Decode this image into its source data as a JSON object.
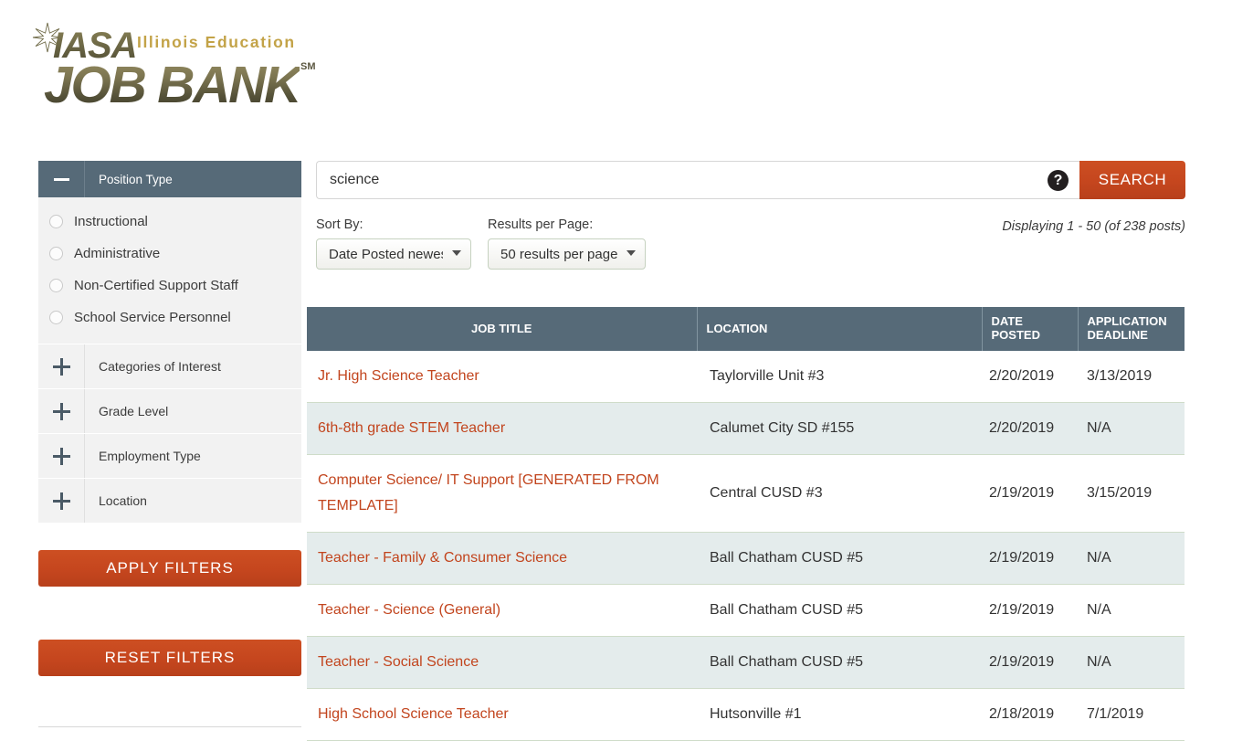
{
  "logo": {
    "star_icon": "star-icon",
    "acronym": "IASA",
    "tagline": "Illinois Education",
    "title": "JOB BANK",
    "trademark": "SM"
  },
  "sidebar": {
    "open_section": {
      "label": "Position Type",
      "toggle_icon": "minus-icon",
      "options": [
        {
          "label": "Instructional"
        },
        {
          "label": "Administrative"
        },
        {
          "label": "Non-Certified Support Staff"
        },
        {
          "label": "School Service Personnel"
        }
      ]
    },
    "closed_sections": [
      {
        "label": "Categories of Interest",
        "toggle_icon": "plus-icon"
      },
      {
        "label": "Grade Level",
        "toggle_icon": "plus-icon"
      },
      {
        "label": "Employment Type",
        "toggle_icon": "plus-icon"
      },
      {
        "label": "Location",
        "toggle_icon": "plus-icon"
      }
    ],
    "apply_label": "APPLY FILTERS",
    "reset_label": "RESET FILTERS"
  },
  "search": {
    "value": "science",
    "placeholder": "",
    "help_icon": "question-mark-icon",
    "help_glyph": "?",
    "button_label": "SEARCH"
  },
  "controls": {
    "sort_by_label": "Sort By:",
    "sort_by_value": "Date Posted newest first",
    "sort_by_options": [
      "Date Posted newest first"
    ],
    "results_per_page_label": "Results per Page:",
    "results_per_page_value": "50 results per page",
    "results_per_page_options": [
      "50 results per page"
    ],
    "displaying": "Displaying 1 - 50 (of 238 posts)"
  },
  "table": {
    "headers": {
      "job_title": "JOB TITLE",
      "location": "LOCATION",
      "date_posted_line1": "DATE",
      "date_posted_line2": "POSTED",
      "deadline_line1": "APPLICATION",
      "deadline_line2": "DEADLINE"
    },
    "rows": [
      {
        "job_title": "Jr. High Science Teacher",
        "location": "Taylorville Unit #3",
        "date_posted": "2/20/2019",
        "deadline": "3/13/2019"
      },
      {
        "job_title": "6th-8th grade STEM Teacher",
        "location": "Calumet City SD #155",
        "date_posted": "2/20/2019",
        "deadline": "N/A"
      },
      {
        "job_title": "Computer Science/ IT Support [GENERATED FROM TEMPLATE]",
        "location": "Central CUSD #3",
        "date_posted": "2/19/2019",
        "deadline": "3/15/2019"
      },
      {
        "job_title": "Teacher - Family & Consumer Science",
        "location": "Ball Chatham CUSD #5",
        "date_posted": "2/19/2019",
        "deadline": "N/A"
      },
      {
        "job_title": "Teacher - Science (General)",
        "location": "Ball Chatham CUSD #5",
        "date_posted": "2/19/2019",
        "deadline": "N/A"
      },
      {
        "job_title": "Teacher - Social Science",
        "location": "Ball Chatham CUSD #5",
        "date_posted": "2/19/2019",
        "deadline": "N/A"
      },
      {
        "job_title": "High School Science Teacher",
        "location": "Hutsonville #1",
        "date_posted": "2/18/2019",
        "deadline": "7/1/2019"
      }
    ]
  },
  "colors": {
    "accent_orange": "#c5461e",
    "header_slate": "#566a78",
    "link_orange": "#c2451e",
    "row_alt": "#e4ecec",
    "gold": "#c3a348"
  }
}
